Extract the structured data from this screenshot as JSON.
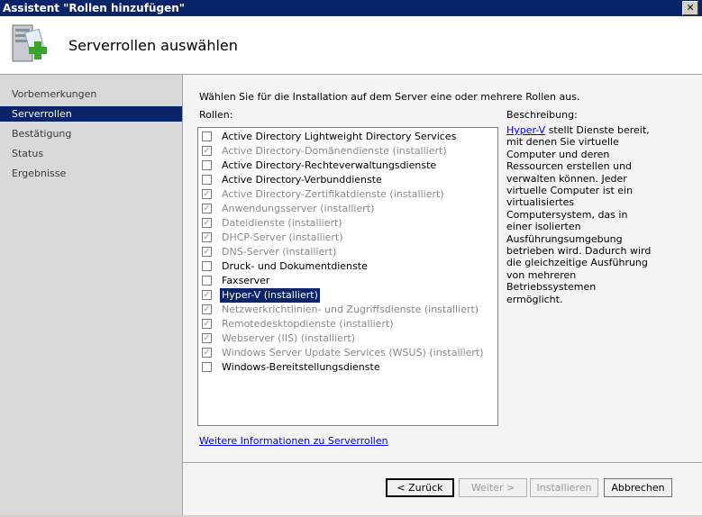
{
  "window": {
    "title": "Assistent \"Rollen hinzufügen\"",
    "close_glyph": "✕"
  },
  "header": {
    "title": "Serverrollen auswählen",
    "icon": "server-add-icon"
  },
  "nav": {
    "items": [
      {
        "label": "Vorbemerkungen",
        "active": false
      },
      {
        "label": "Serverrollen",
        "active": true
      },
      {
        "label": "Bestätigung",
        "active": false
      },
      {
        "label": "Status",
        "active": false
      },
      {
        "label": "Ergebnisse",
        "active": false
      }
    ]
  },
  "main": {
    "instruction": "Wählen Sie für die Installation auf dem Server eine oder mehrere Rollen aus.",
    "roles_label": "Rollen:",
    "description_label": "Beschreibung:",
    "description_link": "Hyper-V",
    "description_text": " stellt Dienste bereit, mit denen Sie virtuelle Computer und deren Ressourcen erstellen und verwalten können. Jeder virtuelle Computer ist ein virtualisiertes Computersystem, das in einer isolierten Ausführungsumgebung betrieben wird. Dadurch wird die gleichzeitige Ausführung von mehreren Betriebssystemen ermöglicht.",
    "more_info_link": "Weitere Informationen zu Serverrollen",
    "roles": [
      {
        "label": "Active Directory Lightweight Directory Services",
        "checked": false,
        "disabled": false,
        "selected": false
      },
      {
        "label": "Active Directory-Domänendienste  (installiert)",
        "checked": true,
        "disabled": true,
        "selected": false
      },
      {
        "label": "Active Directory-Rechteverwaltungsdienste",
        "checked": false,
        "disabled": false,
        "selected": false
      },
      {
        "label": "Active Directory-Verbunddienste",
        "checked": false,
        "disabled": false,
        "selected": false
      },
      {
        "label": "Active Directory-Zertifikatdienste  (installiert)",
        "checked": true,
        "disabled": true,
        "selected": false
      },
      {
        "label": "Anwendungsserver  (installiert)",
        "checked": true,
        "disabled": true,
        "selected": false
      },
      {
        "label": "Dateidienste  (installiert)",
        "checked": true,
        "disabled": true,
        "selected": false
      },
      {
        "label": "DHCP-Server  (installiert)",
        "checked": true,
        "disabled": true,
        "selected": false
      },
      {
        "label": "DNS-Server  (installiert)",
        "checked": true,
        "disabled": true,
        "selected": false
      },
      {
        "label": "Druck- und Dokumentdienste",
        "checked": false,
        "disabled": false,
        "selected": false
      },
      {
        "label": "Faxserver",
        "checked": false,
        "disabled": false,
        "selected": false
      },
      {
        "label": "Hyper-V  (installiert)",
        "checked": true,
        "disabled": true,
        "selected": true
      },
      {
        "label": "Netzwerkrichtlinien- und Zugriffsdienste  (installiert)",
        "checked": true,
        "disabled": true,
        "selected": false
      },
      {
        "label": "Remotedesktopdienste  (installiert)",
        "checked": true,
        "disabled": true,
        "selected": false
      },
      {
        "label": "Webserver (IIS)  (installiert)",
        "checked": true,
        "disabled": true,
        "selected": false
      },
      {
        "label": "Windows Server Update Services (WSUS)  (installiert)",
        "checked": true,
        "disabled": true,
        "selected": false
      },
      {
        "label": "Windows-Bereitstellungsdienste",
        "checked": false,
        "disabled": false,
        "selected": false
      }
    ]
  },
  "buttons": {
    "back": "< Zurück",
    "next": "Weiter >",
    "install": "Installieren",
    "cancel": "Abbrechen"
  },
  "colors": {
    "selection": "#0a246a",
    "link": "#0000ee"
  }
}
